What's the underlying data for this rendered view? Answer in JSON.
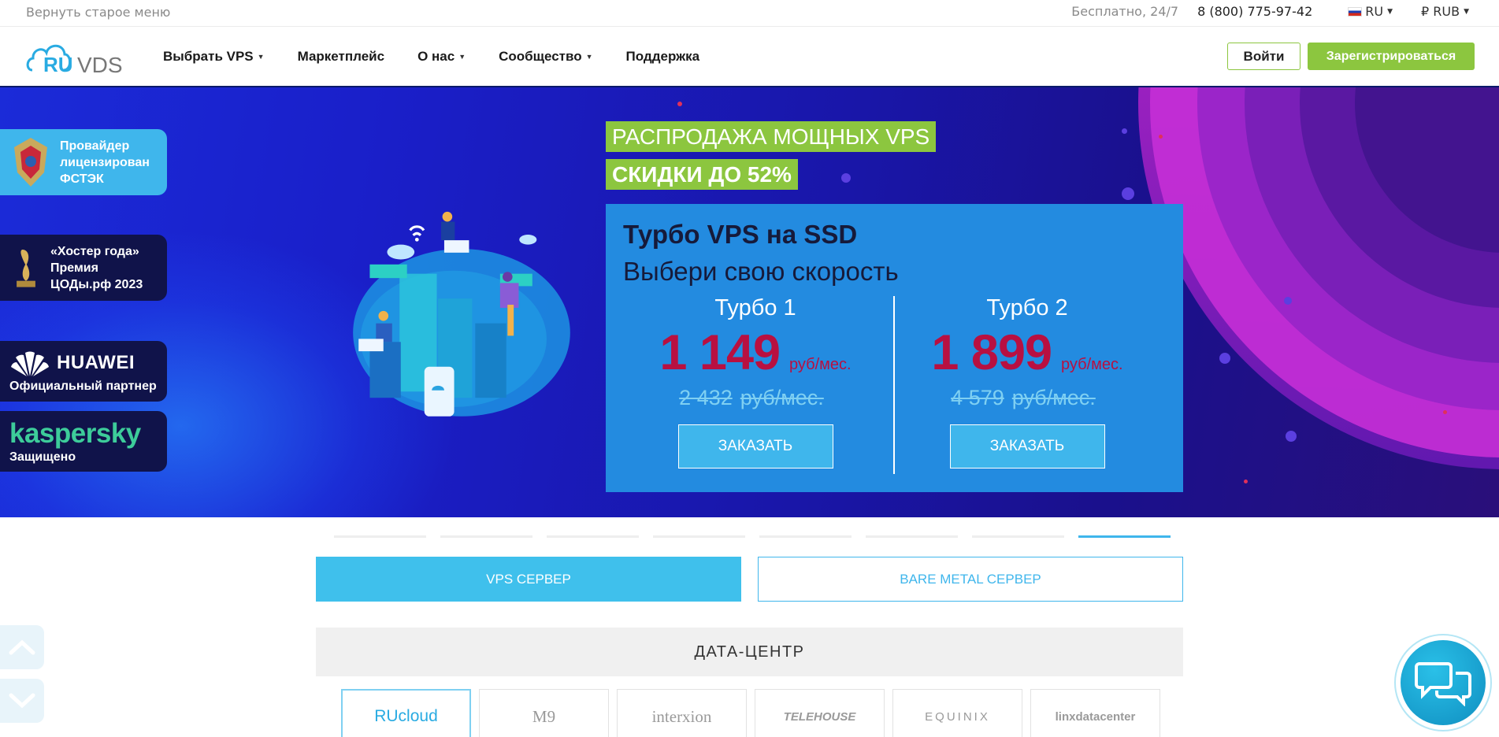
{
  "topbar": {
    "old_menu": "Вернуть старое меню",
    "free": "Бесплатно, 24/7",
    "phone": "8 (800) 775-97-42",
    "language": "RU",
    "currency": "₽ RUB"
  },
  "header": {
    "logo_ru": "RU",
    "logo_vds": "VDS",
    "nav": [
      {
        "label": "Выбрать VPS"
      },
      {
        "label": "Маркетплейс"
      },
      {
        "label": "О нас"
      },
      {
        "label": "Сообщество"
      },
      {
        "label": "Поддержка"
      }
    ],
    "login": "Войти",
    "register": "Зарегистрироваться"
  },
  "badges": {
    "fstek": "Провайдер лицензирован ФСТЭК",
    "fstek_lines": [
      "Провайдер",
      "лицензирован",
      "ФСТЭК"
    ],
    "hoster_lines": [
      "«Хостер года»",
      "Премия",
      "ЦОДы.рф 2023"
    ],
    "huawei_logo": "HUAWEI",
    "huawei_sub": "Официальный партнер",
    "kasp_logo": "kaspersky",
    "kasp_sub": "Защищено"
  },
  "hero": {
    "sale_line1": "РАСПРОДАЖА МОЩНЫХ VPS",
    "sale_line2": "СКИДКИ ДО 52%",
    "title": "Турбо VPS на SSD",
    "subtitle": "Выбери свою скорость",
    "plans": [
      {
        "name": "Турбо 1",
        "price": "1 149",
        "unit": "руб/мес.",
        "old_price": "2 432",
        "old_unit": "руб/мес.",
        "button": "ЗАКАЗАТЬ"
      },
      {
        "name": "Турбо 2",
        "price": "1 899",
        "unit": "руб/мес.",
        "old_price": "4 579",
        "old_unit": "руб/мес.",
        "button": "ЗАКАЗАТЬ"
      }
    ]
  },
  "slider": {
    "count": 8,
    "active_index": 7
  },
  "tabs": {
    "vps": "VPS СЕРВЕР",
    "bare": "BARE METAL СЕРВЕР"
  },
  "datacenter": {
    "heading": "ДАТА-ЦЕНТР",
    "items": [
      {
        "name": "RUcloud"
      },
      {
        "name": "M9"
      },
      {
        "name": "interxion"
      },
      {
        "name": "TELEHOUSE"
      },
      {
        "name": "EQUINIX"
      },
      {
        "name": "linxdatacenter"
      }
    ]
  },
  "icons": {
    "scroll_up": "chevron-up-icon",
    "scroll_down": "chevron-down-icon",
    "chat": "chat-bubbles-icon"
  },
  "colors": {
    "accent_green": "#8cc63f",
    "accent_blue": "#3fb6ec",
    "price_red": "#b81041",
    "hero_bg": "#1a1fc9"
  }
}
